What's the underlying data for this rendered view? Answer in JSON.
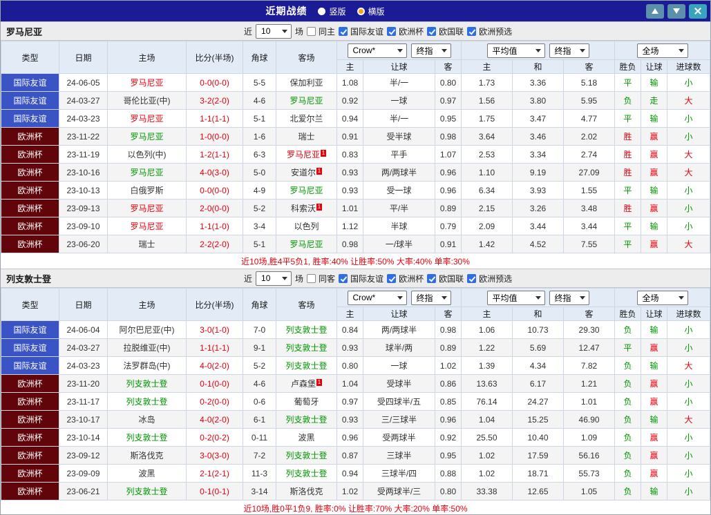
{
  "titlebar": {
    "title": "近期战绩",
    "options": [
      {
        "label": "竖版",
        "selected": false
      },
      {
        "label": "横版",
        "selected": true
      }
    ]
  },
  "sections": [
    {
      "team": "罗马尼亚",
      "controls": {
        "near": "近",
        "count": "10",
        "games": "场",
        "venue": "同主",
        "venue_checked": false
      },
      "filters": [
        {
          "label": "国际友谊",
          "checked": true
        },
        {
          "label": "欧洲杯",
          "checked": true
        },
        {
          "label": "欧国联",
          "checked": true
        },
        {
          "label": "欧洲预选",
          "checked": true
        }
      ],
      "header": {
        "cols": [
          "类型",
          "日期",
          "主场",
          "比分(半场)",
          "角球",
          "客场"
        ],
        "sub": [
          "主",
          "让球",
          "客",
          "主",
          "和",
          "客",
          "胜负",
          "让球",
          "进球数"
        ],
        "book_select": "Crow*",
        "final_select": "终指",
        "avg_select": "平均值",
        "final_select2": "终指",
        "scope_select": "全场"
      },
      "rows": [
        {
          "type": "国际友谊",
          "date": "24-06-05",
          "home": "罗马尼亚",
          "home_c": "red",
          "score": "0-0(0-0)",
          "corner": "5-5",
          "away": "保加利亚",
          "away_c": "black",
          "o1": "1.08",
          "h": "半/一",
          "o2": "0.80",
          "e1": "1.73",
          "ex": "3.36",
          "e3": "5.18",
          "r1": "平",
          "r2": "输",
          "r3": "小"
        },
        {
          "type": "国际友谊",
          "date": "24-03-27",
          "home": "哥伦比亚(中)",
          "home_c": "black",
          "score": "3-2(2-0)",
          "corner": "4-6",
          "away": "罗马尼亚",
          "away_c": "green",
          "o1": "0.92",
          "h": "一球",
          "o2": "0.97",
          "e1": "1.56",
          "ex": "3.80",
          "e3": "5.95",
          "r1": "负",
          "r2": "走",
          "r3": "大"
        },
        {
          "type": "国际友谊",
          "date": "24-03-23",
          "home": "罗马尼亚",
          "home_c": "red",
          "score": "1-1(1-1)",
          "corner": "5-1",
          "away": "北爱尔兰",
          "away_c": "black",
          "o1": "0.94",
          "h": "半/一",
          "o2": "0.95",
          "e1": "1.75",
          "ex": "3.47",
          "e3": "4.77",
          "r1": "平",
          "r2": "输",
          "r3": "小"
        },
        {
          "type": "欧洲杯",
          "date": "23-11-22",
          "home": "罗马尼亚",
          "home_c": "green",
          "score": "1-0(0-0)",
          "corner": "1-6",
          "away": "瑞士",
          "away_c": "black",
          "o1": "0.91",
          "h": "受半球",
          "o2": "0.98",
          "e1": "3.64",
          "ex": "3.46",
          "e3": "2.02",
          "r1": "胜",
          "r2": "赢",
          "r3": "小"
        },
        {
          "type": "欧洲杯",
          "date": "23-11-19",
          "home": "以色列(中)",
          "home_c": "black",
          "score": "1-2(1-1)",
          "corner": "6-3",
          "away": "罗马尼亚",
          "away_c": "red",
          "away_sup": "1",
          "o1": "0.83",
          "h": "平手",
          "o2": "1.07",
          "e1": "2.53",
          "ex": "3.34",
          "e3": "2.74",
          "r1": "胜",
          "r2": "赢",
          "r3": "大"
        },
        {
          "type": "欧洲杯",
          "date": "23-10-16",
          "home": "罗马尼亚",
          "home_c": "green",
          "score": "4-0(3-0)",
          "corner": "5-0",
          "away": "安道尔",
          "away_c": "black",
          "away_sup": "1",
          "o1": "0.93",
          "h": "两/两球半",
          "o2": "0.96",
          "e1": "1.10",
          "ex": "9.19",
          "e3": "27.09",
          "r1": "胜",
          "r2": "赢",
          "r3": "大"
        },
        {
          "type": "欧洲杯",
          "date": "23-10-13",
          "home": "白俄罗斯",
          "home_c": "black",
          "score": "0-0(0-0)",
          "corner": "4-9",
          "away": "罗马尼亚",
          "away_c": "green",
          "o1": "0.93",
          "h": "受一球",
          "o2": "0.96",
          "e1": "6.34",
          "ex": "3.93",
          "e3": "1.55",
          "r1": "平",
          "r2": "输",
          "r3": "小"
        },
        {
          "type": "欧洲杯",
          "date": "23-09-13",
          "home": "罗马尼亚",
          "home_c": "red",
          "score": "2-0(0-0)",
          "corner": "5-2",
          "away": "科索沃",
          "away_c": "black",
          "away_sup": "1",
          "o1": "1.01",
          "h": "平/半",
          "o2": "0.89",
          "e1": "2.15",
          "ex": "3.26",
          "e3": "3.48",
          "r1": "胜",
          "r2": "赢",
          "r3": "小"
        },
        {
          "type": "欧洲杯",
          "date": "23-09-10",
          "home": "罗马尼亚",
          "home_c": "red",
          "score": "1-1(1-0)",
          "corner": "3-4",
          "away": "以色列",
          "away_c": "black",
          "o1": "1.12",
          "h": "半球",
          "o2": "0.79",
          "e1": "2.09",
          "ex": "3.44",
          "e3": "3.44",
          "r1": "平",
          "r2": "输",
          "r3": "小"
        },
        {
          "type": "欧洲杯",
          "date": "23-06-20",
          "home": "瑞士",
          "home_c": "black",
          "score": "2-2(2-0)",
          "corner": "5-1",
          "away": "罗马尼亚",
          "away_c": "green",
          "o1": "0.98",
          "h": "一/球半",
          "o2": "0.91",
          "e1": "1.42",
          "ex": "4.52",
          "e3": "7.55",
          "r1": "平",
          "r2": "赢",
          "r3": "大"
        }
      ],
      "summary": "近10场,胜4平5负1, 胜率:40% 让胜率:50% 大率:40% 单率:30%"
    },
    {
      "team": "列支敦士登",
      "controls": {
        "near": "近",
        "count": "10",
        "games": "场",
        "venue": "同客",
        "venue_checked": false
      },
      "filters": [
        {
          "label": "国际友谊",
          "checked": true
        },
        {
          "label": "欧洲杯",
          "checked": true
        },
        {
          "label": "欧国联",
          "checked": true
        },
        {
          "label": "欧洲预选",
          "checked": true
        }
      ],
      "header": {
        "cols": [
          "类型",
          "日期",
          "主场",
          "比分(半场)",
          "角球",
          "客场"
        ],
        "sub": [
          "主",
          "让球",
          "客",
          "主",
          "和",
          "客",
          "胜负",
          "让球",
          "进球数"
        ],
        "book_select": "Crow*",
        "final_select": "终指",
        "avg_select": "平均值",
        "final_select2": "终指",
        "scope_select": "全场"
      },
      "rows": [
        {
          "type": "国际友谊",
          "date": "24-06-04",
          "home": "阿尔巴尼亚(中)",
          "home_c": "black",
          "score": "3-0(1-0)",
          "corner": "7-0",
          "away": "列支敦士登",
          "away_c": "green",
          "o1": "0.84",
          "h": "两/两球半",
          "o2": "0.98",
          "e1": "1.06",
          "ex": "10.73",
          "e3": "29.30",
          "r1": "负",
          "r2": "输",
          "r3": "小"
        },
        {
          "type": "国际友谊",
          "date": "24-03-27",
          "home": "拉脱维亚(中)",
          "home_c": "black",
          "score": "1-1(1-1)",
          "corner": "9-1",
          "away": "列支敦士登",
          "away_c": "green",
          "o1": "0.93",
          "h": "球半/两",
          "o2": "0.89",
          "e1": "1.22",
          "ex": "5.69",
          "e3": "12.47",
          "r1": "平",
          "r2": "赢",
          "r3": "小"
        },
        {
          "type": "国际友谊",
          "date": "24-03-23",
          "home": "法罗群岛(中)",
          "home_c": "black",
          "score": "4-0(2-0)",
          "corner": "5-2",
          "away": "列支敦士登",
          "away_c": "green",
          "o1": "0.80",
          "h": "一球",
          "o2": "1.02",
          "e1": "1.39",
          "ex": "4.34",
          "e3": "7.82",
          "r1": "负",
          "r2": "输",
          "r3": "大"
        },
        {
          "type": "欧洲杯",
          "date": "23-11-20",
          "home": "列支敦士登",
          "home_c": "green",
          "score": "0-1(0-0)",
          "corner": "4-6",
          "away": "卢森堡",
          "away_c": "black",
          "away_sup": "1",
          "o1": "1.04",
          "h": "受球半",
          "o2": "0.86",
          "e1": "13.63",
          "ex": "6.17",
          "e3": "1.21",
          "r1": "负",
          "r2": "赢",
          "r3": "小"
        },
        {
          "type": "欧洲杯",
          "date": "23-11-17",
          "home": "列支敦士登",
          "home_c": "green",
          "score": "0-2(0-0)",
          "corner": "0-6",
          "away": "葡萄牙",
          "away_c": "black",
          "o1": "0.97",
          "h": "受四球半/五",
          "o2": "0.85",
          "e1": "76.14",
          "ex": "24.27",
          "e3": "1.01",
          "r1": "负",
          "r2": "赢",
          "r3": "小"
        },
        {
          "type": "欧洲杯",
          "date": "23-10-17",
          "home": "冰岛",
          "home_c": "black",
          "score": "4-0(2-0)",
          "corner": "6-1",
          "away": "列支敦士登",
          "away_c": "green",
          "o1": "0.93",
          "h": "三/三球半",
          "o2": "0.96",
          "e1": "1.04",
          "ex": "15.25",
          "e3": "46.90",
          "r1": "负",
          "r2": "输",
          "r3": "大"
        },
        {
          "type": "欧洲杯",
          "date": "23-10-14",
          "home": "列支敦士登",
          "home_c": "green",
          "score": "0-2(0-2)",
          "corner": "0-11",
          "away": "波黑",
          "away_c": "black",
          "o1": "0.96",
          "h": "受两球半",
          "o2": "0.92",
          "e1": "25.50",
          "ex": "10.40",
          "e3": "1.09",
          "r1": "负",
          "r2": "赢",
          "r3": "小"
        },
        {
          "type": "欧洲杯",
          "date": "23-09-12",
          "home": "斯洛伐克",
          "home_c": "black",
          "score": "3-0(3-0)",
          "corner": "7-2",
          "away": "列支敦士登",
          "away_c": "green",
          "o1": "0.87",
          "h": "三球半",
          "o2": "0.95",
          "e1": "1.02",
          "ex": "17.59",
          "e3": "56.16",
          "r1": "负",
          "r2": "赢",
          "r3": "小"
        },
        {
          "type": "欧洲杯",
          "date": "23-09-09",
          "home": "波黑",
          "home_c": "black",
          "score": "2-1(2-1)",
          "corner": "11-3",
          "away": "列支敦士登",
          "away_c": "green",
          "o1": "0.94",
          "h": "三球半/四",
          "o2": "0.88",
          "e1": "1.02",
          "ex": "18.71",
          "e3": "55.73",
          "r1": "负",
          "r2": "赢",
          "r3": "小"
        },
        {
          "type": "欧洲杯",
          "date": "23-06-21",
          "home": "列支敦士登",
          "home_c": "green",
          "score": "0-1(0-1)",
          "corner": "3-14",
          "away": "斯洛伐克",
          "away_c": "black",
          "o1": "1.02",
          "h": "受两球半/三",
          "o2": "0.80",
          "e1": "33.38",
          "ex": "12.65",
          "e3": "1.05",
          "r1": "负",
          "r2": "输",
          "r3": "小"
        }
      ],
      "summary": "近10场,胜0平1负9, 胜率:0% 让胜率:70% 大率:20% 单率:50%"
    }
  ]
}
